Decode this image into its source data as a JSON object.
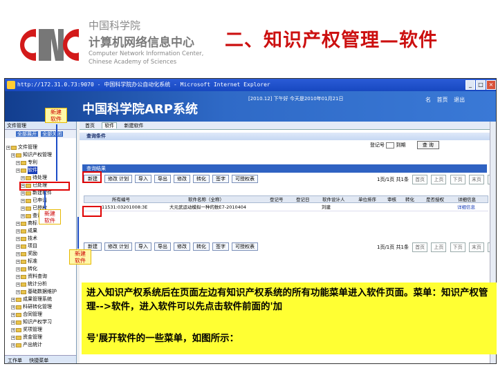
{
  "header": {
    "org_cn": "中国科学院",
    "org_center": "计算机网络信息中心",
    "org_en_line1": "Computer Network Information Center,",
    "org_en_line2": "Chinese Academy of Sciences",
    "slide_title": "二、知识产权管理—软件",
    "logo_name": "cnic-logo"
  },
  "browser": {
    "title": "http://172.31.0.73:9070 - 中国科学院办公自动化系统 - Microsoft Internet Explorer",
    "min_label": "_",
    "max_label": "□",
    "close_label": "×"
  },
  "app": {
    "title": "中国科学院ARP系统",
    "date_text": "[2010.12] 下午好 今天是2010年01月21日",
    "links": [
      "名",
      "首页",
      "退出"
    ]
  },
  "badges": {
    "badge1": "新建\n软件",
    "badge2": "新建\n软件",
    "badge3": "新建\n软件"
  },
  "left": {
    "tabs": "文件管理",
    "toolbar_buttons": [
      "全部展开",
      "全部关闭"
    ],
    "tree": [
      {
        "label": "文件管理",
        "indent": 0,
        "selected": false
      },
      {
        "label": "知识产权管理",
        "indent": 1,
        "selected": false
      },
      {
        "label": "专利",
        "indent": 2,
        "selected": false
      },
      {
        "label": "软件",
        "indent": 2,
        "selected": true
      },
      {
        "label": "待处理",
        "indent": 3,
        "selected": false
      },
      {
        "label": "已处理",
        "indent": 3,
        "selected": false
      },
      {
        "label": "新建软件",
        "indent": 3,
        "selected": false
      },
      {
        "label": "已申请",
        "indent": 3,
        "selected": false
      },
      {
        "label": "已授权",
        "indent": 3,
        "selected": false
      },
      {
        "label": "查询统计",
        "indent": 3,
        "selected": false
      },
      {
        "label": "商标",
        "indent": 2,
        "selected": false
      },
      {
        "label": "成果",
        "indent": 2,
        "selected": false
      },
      {
        "label": "技术",
        "indent": 2,
        "selected": false
      },
      {
        "label": "项目",
        "indent": 2,
        "selected": false
      },
      {
        "label": "奖励",
        "indent": 2,
        "selected": false
      },
      {
        "label": "标准",
        "indent": 2,
        "selected": false
      },
      {
        "label": "转化",
        "indent": 2,
        "selected": false
      },
      {
        "label": "资料查询",
        "indent": 2,
        "selected": false
      },
      {
        "label": "统计分析",
        "indent": 2,
        "selected": false
      },
      {
        "label": "基础数据维护",
        "indent": 2,
        "selected": false
      },
      {
        "label": "成果管理系统",
        "indent": 1,
        "selected": false
      },
      {
        "label": "科研转化管理",
        "indent": 1,
        "selected": false
      },
      {
        "label": "合同管理",
        "indent": 1,
        "selected": false
      },
      {
        "label": "知识产权学习",
        "indent": 1,
        "selected": false
      },
      {
        "label": "奖项管理",
        "indent": 1,
        "selected": false
      },
      {
        "label": "资金管理",
        "indent": 1,
        "selected": false
      },
      {
        "label": "产出统计",
        "indent": 1,
        "selected": false
      }
    ],
    "bottom_tabs": [
      "工作单",
      "快捷菜单"
    ]
  },
  "right": {
    "tabs": [
      "首页",
      "软件",
      "新建软件"
    ],
    "panel1_title": "查询条件",
    "query_label1": "登记号",
    "query_label2": "到期",
    "query_button": "查  询",
    "result_title": "查询结果",
    "buttons": [
      "新建",
      "修改  计划",
      "导入",
      "导出",
      "修改",
      "转化",
      "签字",
      "可授权表"
    ],
    "pager_text1": "1页/1页  共1条",
    "pager_text2": "1页/1页  共1条",
    "pager_buttons": [
      "首页",
      "上页",
      "下页",
      "末页",
      "跳转"
    ],
    "columns": [
      "",
      "所有编号",
      "软件名称（全称）",
      "登记号",
      "登记日",
      "软件设计人",
      "单位排序",
      "审核",
      "转化",
      "是否授权",
      "详细信息"
    ],
    "rows": [
      {
        "id": "11531:03201008:3E",
        "name": "大元武运动模拟一种的数E7-2010404",
        "reg": "",
        "date": "",
        "designer": "刘建",
        "order": "",
        "audit": "",
        "transfer": "",
        "auth": "",
        "detail": "详细信息"
      }
    ]
  },
  "description": {
    "paragraph": "进入知识产权系统后在页面左边有知识产权系统的所有功能菜单进入软件页面。菜单：知识产权管理-->软件，进入软件可以先点击软件前面的'加",
    "paragraph2": "号'展开软件的一些菜单，如图所示："
  }
}
